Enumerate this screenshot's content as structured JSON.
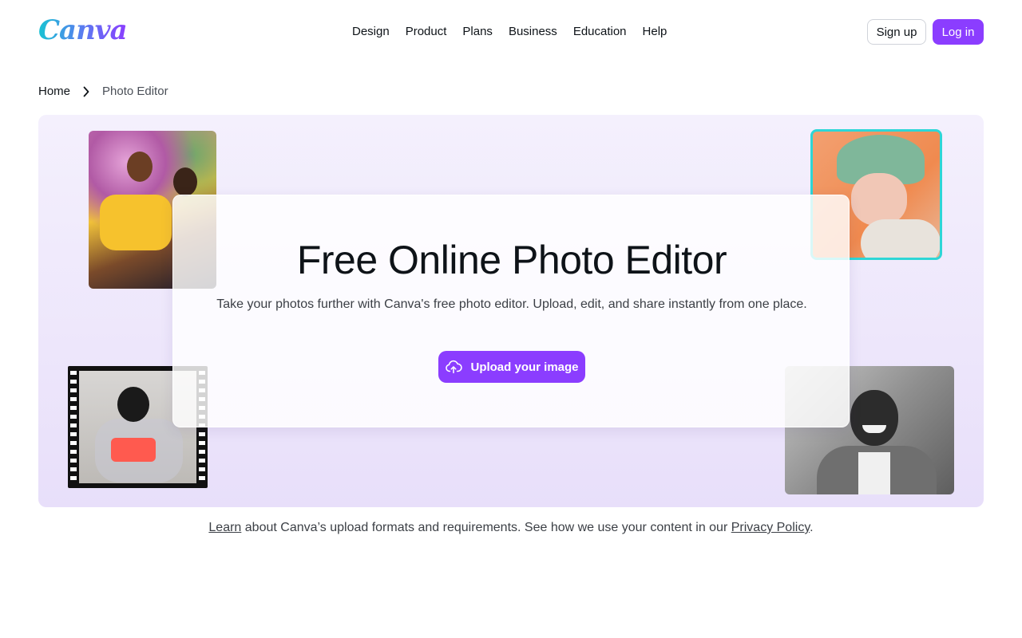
{
  "header": {
    "logo_text": "Canva",
    "nav": [
      "Design",
      "Product",
      "Plans",
      "Business",
      "Education",
      "Help"
    ],
    "signup_label": "Sign up",
    "login_label": "Log in"
  },
  "breadcrumb": {
    "home": "Home",
    "current": "Photo Editor",
    "separator_icon": "chevron-right-icon"
  },
  "hero": {
    "title": "Free Online Photo Editor",
    "subtitle": "Take your photos further with Canva's free photo editor. Upload, edit, and share instantly from one place.",
    "upload_label": "Upload your image",
    "upload_icon": "cloud-upload-icon"
  },
  "note": {
    "learn_link": "Learn",
    "text_middle": " about Canva’s upload formats and requirements. See how we use your content in our ",
    "privacy_link": "Privacy Policy",
    "text_end": "."
  },
  "colors": {
    "accent": "#8b3dff",
    "hero_bg": "#ede6fb",
    "photo_frame": "#2ed6d6"
  }
}
